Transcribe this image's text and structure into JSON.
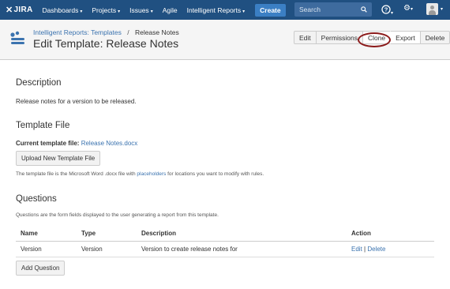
{
  "nav": {
    "logo": "JIRA",
    "items": [
      {
        "label": "Dashboards",
        "caret": true
      },
      {
        "label": "Projects",
        "caret": true
      },
      {
        "label": "Issues",
        "caret": true
      },
      {
        "label": "Agile",
        "caret": false
      },
      {
        "label": "Intelligent Reports",
        "caret": true
      }
    ],
    "create_label": "Create",
    "search_placeholder": "Search",
    "help_icon": "help-icon",
    "settings_icon": "gear-icon"
  },
  "header": {
    "breadcrumb_link": "Intelligent Reports: Templates",
    "breadcrumb_sep": "/",
    "breadcrumb_current": "Release Notes",
    "title": "Edit Template: Release Notes",
    "buttons": {
      "edit": "Edit",
      "permissions": "Permissions",
      "clone": "Clone",
      "export": "Export",
      "delete": "Delete"
    }
  },
  "description": {
    "heading": "Description",
    "text": "Release notes for a version to be released."
  },
  "template_file": {
    "heading": "Template File",
    "current_label": "Current template file:",
    "current_file": "Release Notes.docx",
    "upload_label": "Upload New Template File",
    "note_before": "The template file is the Microsoft Word .docx file with ",
    "note_link": "placeholders",
    "note_after": " for locations you want to modify with rules."
  },
  "questions": {
    "heading": "Questions",
    "note": "Questions are the form fields displayed to the user generating a report from this template.",
    "columns": {
      "name": "Name",
      "type": "Type",
      "description": "Description",
      "action": "Action"
    },
    "rows": [
      {
        "name": "Version",
        "type": "Version",
        "description": "Version to create release notes for",
        "edit": "Edit",
        "sep": "|",
        "delete": "Delete"
      }
    ],
    "add_label": "Add Question"
  },
  "colors": {
    "nav_bg": "#205081",
    "link": "#3b73af",
    "annotation_ring": "#8b1a1a"
  }
}
